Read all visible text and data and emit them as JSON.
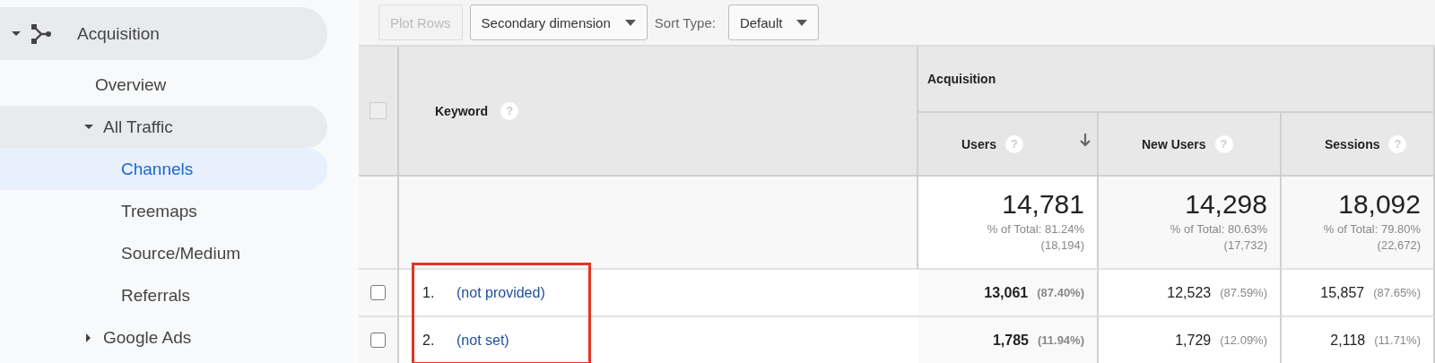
{
  "sidebar": {
    "items": [
      {
        "label": "Acquisition",
        "kind": "section",
        "expanded": true,
        "selected": false,
        "children": [
          {
            "label": "Overview",
            "selected": false
          },
          {
            "label": "All Traffic",
            "expanded": true,
            "selected": false,
            "children": [
              {
                "label": "Channels",
                "selected": true
              },
              {
                "label": "Treemaps",
                "selected": false
              },
              {
                "label": "Source/Medium",
                "selected": false
              },
              {
                "label": "Referrals",
                "selected": false
              }
            ]
          },
          {
            "label": "Google Ads",
            "expanded": false,
            "selected": false
          }
        ]
      }
    ]
  },
  "toolbar": {
    "plot_rows": {
      "label": "Plot Rows",
      "disabled": true
    },
    "secondary_dimension": {
      "label": "Secondary dimension"
    },
    "sort_type": {
      "label": "Sort Type:",
      "value": "Default"
    }
  },
  "table": {
    "select_all": {
      "checked": false
    },
    "keyword_column": {
      "label": "Keyword",
      "help": "?"
    },
    "group": "Acquisition",
    "columns": [
      {
        "label": "Users",
        "help": "?",
        "sorted": true
      },
      {
        "label": "New Users",
        "help": "?",
        "sorted": false
      },
      {
        "label": "Sessions",
        "help": "?",
        "sorted": false
      }
    ],
    "totals": [
      {
        "value": "14,781",
        "share": "% of Total: 81.24%",
        "total": "(18,194)"
      },
      {
        "value": "14,298",
        "share": "% of Total: 80.63%",
        "total": "(17,732)"
      },
      {
        "value": "18,092",
        "share": "% of Total: 79.80%",
        "total": "(22,672)"
      }
    ],
    "rows": [
      {
        "index": "1.",
        "keyword": "(not provided)",
        "checked": false,
        "highlighted": true,
        "cells": [
          {
            "value": "13,061",
            "pct": "(87.40%)"
          },
          {
            "value": "12,523",
            "pct": "(87.59%)"
          },
          {
            "value": "15,857",
            "pct": "(87.65%)"
          }
        ]
      },
      {
        "index": "2.",
        "keyword": "(not set)",
        "checked": false,
        "highlighted": true,
        "cells": [
          {
            "value": "1,785",
            "pct": "(11.94%)"
          },
          {
            "value": "1,729",
            "pct": "(12.09%)"
          },
          {
            "value": "2,118",
            "pct": "(11.71%)"
          }
        ]
      }
    ]
  }
}
